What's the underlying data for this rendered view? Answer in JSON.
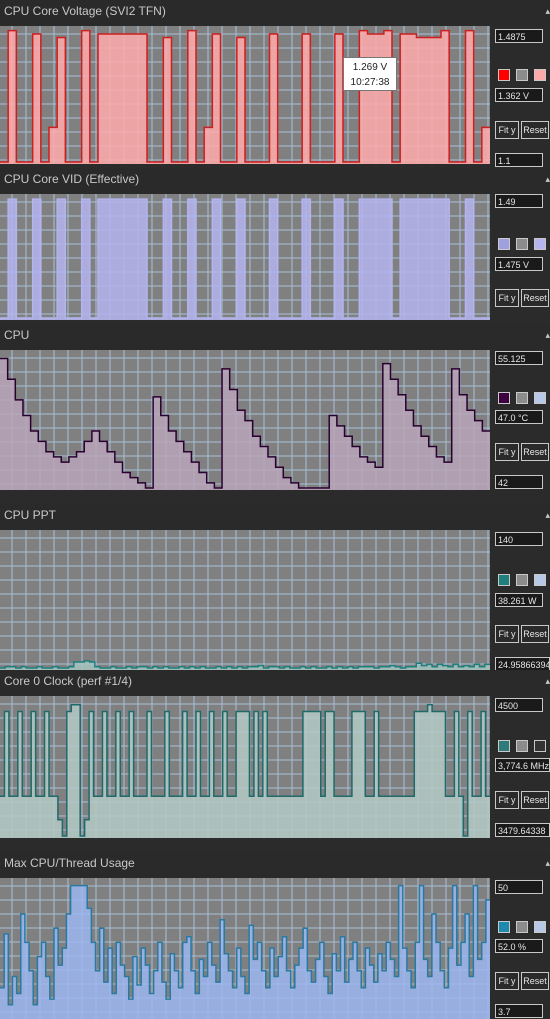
{
  "panels": [
    {
      "title": "CPU Core Voltage (SVI2 TFN)",
      "max": "1.4875",
      "current": "1.362 V",
      "min": "1.1",
      "fit_label": "Fit y",
      "reset_label": "Reset",
      "colors": {
        "line": "#cc1f1f",
        "fill": "#ffaaaa",
        "swatch1": "#ff0000",
        "swatch2": "#8c8c8c",
        "swatch3": "#ffaaaa"
      }
    },
    {
      "title": "CPU Core VID (Effective)",
      "max": "1.49",
      "current": "1.475 V",
      "min": "",
      "fit_label": "Fit y",
      "reset_label": "Reset",
      "colors": {
        "line": "#b4b4ee",
        "fill": "#b4b4ee",
        "swatch1": "#a0a0e0",
        "swatch2": "#8c8c8c",
        "swatch3": "#b4b4ee"
      }
    },
    {
      "title": "CPU",
      "max": "55.125",
      "current": "47.0 °C",
      "min": "42",
      "fit_label": "Fit y",
      "reset_label": "Reset",
      "colors": {
        "line": "#2a0030",
        "fill": "#b8a4b8",
        "swatch1": "#3c0040",
        "swatch2": "#8c8c8c",
        "swatch3": "#b8c8e8"
      }
    },
    {
      "title": "CPU PPT",
      "max": "140",
      "current": "38.261 W",
      "min": "24.95866394",
      "fit_label": "Fit y",
      "reset_label": "Reset",
      "colors": {
        "line": "#1f7e7e",
        "fill": "#a6c4c0",
        "swatch1": "#1f7e7e",
        "swatch2": "#8c8c8c",
        "swatch3": "#b8c8e8"
      }
    },
    {
      "title": "Core 0 Clock (perf #1/4)",
      "max": "4500",
      "current": "3,774.6 MHz",
      "min": "3479.64338",
      "fit_label": "Fit y",
      "reset_label": "Reset",
      "colors": {
        "line": "#1f6a6a",
        "fill": "#b4cac6",
        "swatch1": "#2f7a7a",
        "swatch2": "#8c8c8c",
        "swatch3": "#333333"
      }
    },
    {
      "title": "Max CPU/Thread Usage",
      "max": "50",
      "current": "52.0 %",
      "min": "3.7",
      "fit_label": "Fit y",
      "reset_label": "Reset",
      "colors": {
        "line": "#2a7aa0",
        "fill": "#9cb6f0",
        "swatch1": "#1f8ab0",
        "swatch2": "#8c8c8c",
        "swatch3": "#b8c8e8"
      }
    }
  ],
  "tooltip": {
    "value": "1.269 V",
    "time": "10:27:38"
  },
  "chart_data": [
    {
      "type": "area",
      "series": [
        {
          "name": "CPU Core Voltage (SVI2 TFN)",
          "values": [
            1.1,
            1.48,
            1.1,
            1.1,
            1.47,
            1.1,
            1.2,
            1.46,
            1.1,
            1.1,
            1.48,
            1.1,
            1.47,
            1.47,
            1.47,
            1.47,
            1.47,
            1.47,
            1.1,
            1.1,
            1.46,
            1.1,
            1.1,
            1.48,
            1.1,
            1.2,
            1.47,
            1.1,
            1.1,
            1.46,
            1.1,
            1.1,
            1.1,
            1.47,
            1.1,
            1.1,
            1.1,
            1.47,
            1.1,
            1.1,
            1.1,
            1.47,
            1.1,
            1.1,
            1.48,
            1.47,
            1.47,
            1.48,
            1.1,
            1.47,
            1.47,
            1.46,
            1.46,
            1.46,
            1.48,
            1.1,
            1.1,
            1.48,
            1.1,
            1.2
          ]
        }
      ],
      "ylim": [
        1.1,
        1.4875
      ]
    },
    {
      "type": "area",
      "series": [
        {
          "name": "CPU Core VID (Effective)",
          "values": [
            1.1,
            1.48,
            1.1,
            1.1,
            1.48,
            1.1,
            1.1,
            1.48,
            1.1,
            1.1,
            1.48,
            1.1,
            1.48,
            1.48,
            1.48,
            1.48,
            1.48,
            1.48,
            1.1,
            1.1,
            1.48,
            1.1,
            1.1,
            1.48,
            1.1,
            1.1,
            1.48,
            1.1,
            1.1,
            1.48,
            1.1,
            1.1,
            1.1,
            1.48,
            1.1,
            1.1,
            1.1,
            1.48,
            1.1,
            1.1,
            1.1,
            1.48,
            1.1,
            1.1,
            1.48,
            1.48,
            1.48,
            1.48,
            1.1,
            1.48,
            1.48,
            1.48,
            1.48,
            1.48,
            1.48,
            1.1,
            1.1,
            1.48,
            1.1,
            1.1
          ]
        }
      ],
      "ylim": [
        1.1,
        1.49
      ]
    },
    {
      "type": "area",
      "series": [
        {
          "name": "CPU",
          "values": [
            54.5,
            52.5,
            50.5,
            49.0,
            47.5,
            46.5,
            45.5,
            45.0,
            44.5,
            45.0,
            45.5,
            46.5,
            47.5,
            46.5,
            45.5,
            44.5,
            43.5,
            43.0,
            42.5,
            42.0,
            50.8,
            49.0,
            47.5,
            46.5,
            45.5,
            44.5,
            43.5,
            42.5,
            42.0,
            53.5,
            51.5,
            49.5,
            48.5,
            47.0,
            46.0,
            45.0,
            44.0,
            43.0,
            42.5,
            42.0,
            42.0,
            42.0,
            42.0,
            49.0,
            48.0,
            47.0,
            46.0,
            45.0,
            44.5,
            44.0,
            54.0,
            52.5,
            51.0,
            49.5,
            48.0,
            47.0,
            46.0,
            45.0,
            44.5,
            53.5,
            51.0,
            49.5,
            48.5,
            47.5
          ]
        }
      ],
      "ylim": [
        42,
        55.125
      ]
    },
    {
      "type": "area",
      "series": [
        {
          "name": "CPU PPT",
          "values": [
            25,
            26,
            26,
            25,
            26,
            25,
            25,
            26,
            25,
            25,
            26,
            25,
            25,
            26,
            30,
            30,
            31,
            30,
            26,
            25,
            25,
            26,
            25,
            25,
            26,
            25,
            26,
            26,
            25,
            26,
            25,
            26,
            25,
            25,
            26,
            25,
            26,
            25,
            26,
            25,
            25,
            26,
            25,
            26,
            25,
            26,
            25,
            26,
            26,
            27,
            25,
            26,
            26,
            25,
            26,
            25,
            25,
            26,
            25,
            26,
            25,
            25,
            26,
            25,
            26,
            25,
            26,
            25,
            26,
            26,
            26,
            25,
            26,
            26,
            27,
            26,
            25,
            26,
            26,
            29,
            27,
            28,
            26,
            28,
            27,
            26,
            28,
            26,
            27,
            26,
            28,
            26,
            28
          ]
        }
      ],
      "ylim": [
        24.95866394,
        140
      ]
    },
    {
      "type": "area",
      "series": [
        {
          "name": "Core 0 Clock (perf #1/4)",
          "values": [
            3774,
            4400,
            3774,
            3774,
            4400,
            3774,
            3774,
            4400,
            3774,
            3774,
            4400,
            3774,
            3774,
            3600,
            3480,
            4400,
            4450,
            4450,
            3480,
            3600,
            4400,
            3774,
            3774,
            4400,
            3774,
            3774,
            4400,
            3774,
            3774,
            4400,
            3774,
            3774,
            3774,
            4400,
            3774,
            3774,
            3774,
            4400,
            3774,
            3774,
            3774,
            4400,
            3774,
            3774,
            4400,
            3774,
            3774,
            4400,
            3774,
            3774,
            4400,
            3774,
            3774,
            4400,
            4400,
            4400,
            3774,
            4400,
            3774,
            4400,
            3774,
            3774,
            3774,
            3774,
            3774,
            3774,
            3774,
            3774,
            4400,
            4400,
            4400,
            4400,
            3774,
            4400,
            4400,
            3774,
            3774,
            3774,
            3774,
            4400,
            4400,
            4400,
            3774,
            3774,
            4400,
            3774,
            3774,
            3774,
            3774,
            3774,
            3774,
            3774,
            3774,
            4400,
            4400,
            4400,
            4450,
            4400,
            4400,
            4400,
            3774,
            3774,
            4400,
            3774,
            3480,
            4400,
            3774,
            3774,
            4400,
            3774
          ]
        }
      ],
      "ylim": [
        3479.64338,
        4500
      ]
    },
    {
      "type": "area",
      "series": [
        {
          "name": "Max CPU/Thread Usage",
          "values": [
            14,
            33,
            8,
            18,
            12,
            40,
            30,
            20,
            8,
            25,
            30,
            18,
            10,
            35,
            22,
            28,
            40,
            50,
            50,
            50,
            50,
            42,
            30,
            20,
            35,
            16,
            28,
            12,
            30,
            22,
            18,
            10,
            25,
            15,
            28,
            22,
            12,
            20,
            30,
            16,
            10,
            26,
            20,
            14,
            30,
            32,
            20,
            12,
            24,
            18,
            30,
            22,
            16,
            38,
            26,
            20,
            14,
            28,
            18,
            12,
            36,
            24,
            30,
            20,
            14,
            28,
            18,
            25,
            32,
            20,
            14,
            22,
            28,
            35,
            20,
            16,
            24,
            30,
            18,
            12,
            26,
            20,
            32,
            16,
            24,
            30,
            20,
            14,
            28,
            22,
            16,
            26,
            20,
            30,
            24,
            18,
            50,
            28,
            20,
            14,
            30,
            50,
            24,
            18,
            40,
            30,
            20,
            14,
            28,
            50,
            22,
            30,
            40,
            18,
            50,
            24,
            30,
            45
          ]
        }
      ],
      "ylim": [
        3.7,
        52
      ]
    }
  ]
}
